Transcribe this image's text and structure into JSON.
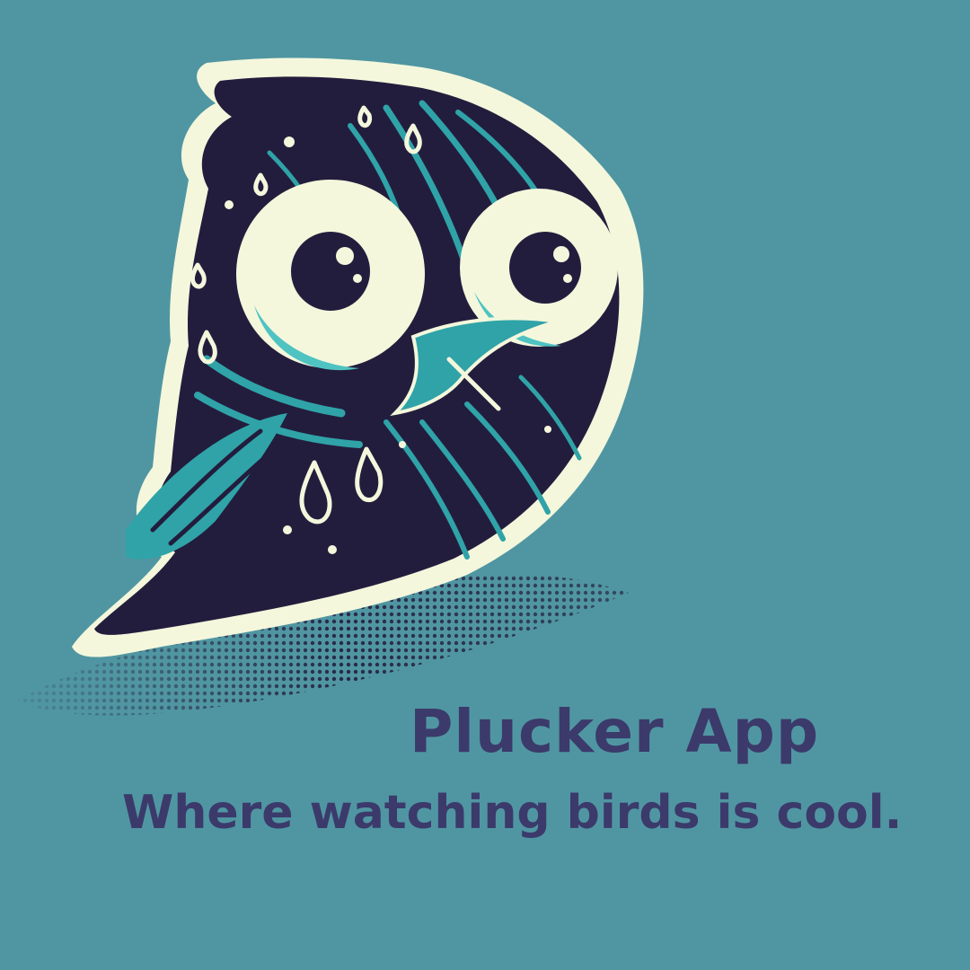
{
  "brand": {
    "title": "Plucker App",
    "tagline": "Where watching birds is cool."
  },
  "illustration": {
    "subject": "bird-mascot-icon"
  },
  "colors": {
    "background": "#5096a2",
    "text": "#3b3a6b",
    "bird_dark": "#231d3d",
    "bird_teal": "#2fa3a8",
    "bird_light_teal": "#4ec3c2",
    "outline_cream": "#f4f7dc"
  }
}
